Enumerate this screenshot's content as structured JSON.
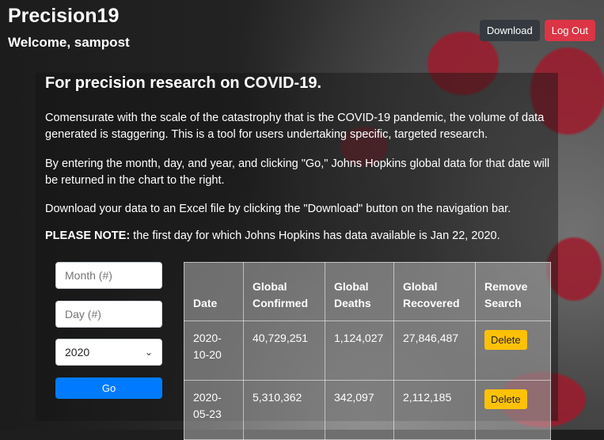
{
  "header": {
    "brand": "Precision19",
    "welcome": "Welcome, sampost"
  },
  "nav": {
    "download_label": "Download",
    "logout_label": "Log Out"
  },
  "intro": {
    "headline": "For precision research on COVID-19.",
    "p1": "Comensurate with the scale of the catastrophy that is the COVID-19 pandemic, the volume of data generated is staggering. This is a tool for users undertaking specific, targeted research.",
    "p2": "By entering the month, day, and year, and clicking \"Go,\" Johns Hopkins global data for that date will be returned in the chart to the right.",
    "p3": "Download your data to an Excel file by clicking the \"Download\" button on the navigation bar.",
    "note_label": "PLEASE NOTE:",
    "note_text": " the first day for which Johns Hopkins has data available is Jan 22, 2020."
  },
  "form": {
    "month_placeholder": "Month (#)",
    "day_placeholder": "Day (#)",
    "year_value": "2020",
    "go_label": "Go"
  },
  "table": {
    "headers": [
      "Date",
      "Global Confirmed",
      "Global Deaths",
      "Global Recovered",
      "Remove Search"
    ],
    "rows": [
      {
        "date": "2020-10-20",
        "confirmed": "40,729,251",
        "deaths": "1,124,027",
        "recovered": "27,846,487",
        "action": "Delete"
      },
      {
        "date": "2020-05-23",
        "confirmed": "5,310,362",
        "deaths": "342,097",
        "recovered": "2,112,185",
        "action": "Delete"
      }
    ]
  },
  "colors": {
    "primary": "#007bff",
    "danger": "#dc3545",
    "warning": "#ffc107",
    "dark": "#343a40"
  }
}
